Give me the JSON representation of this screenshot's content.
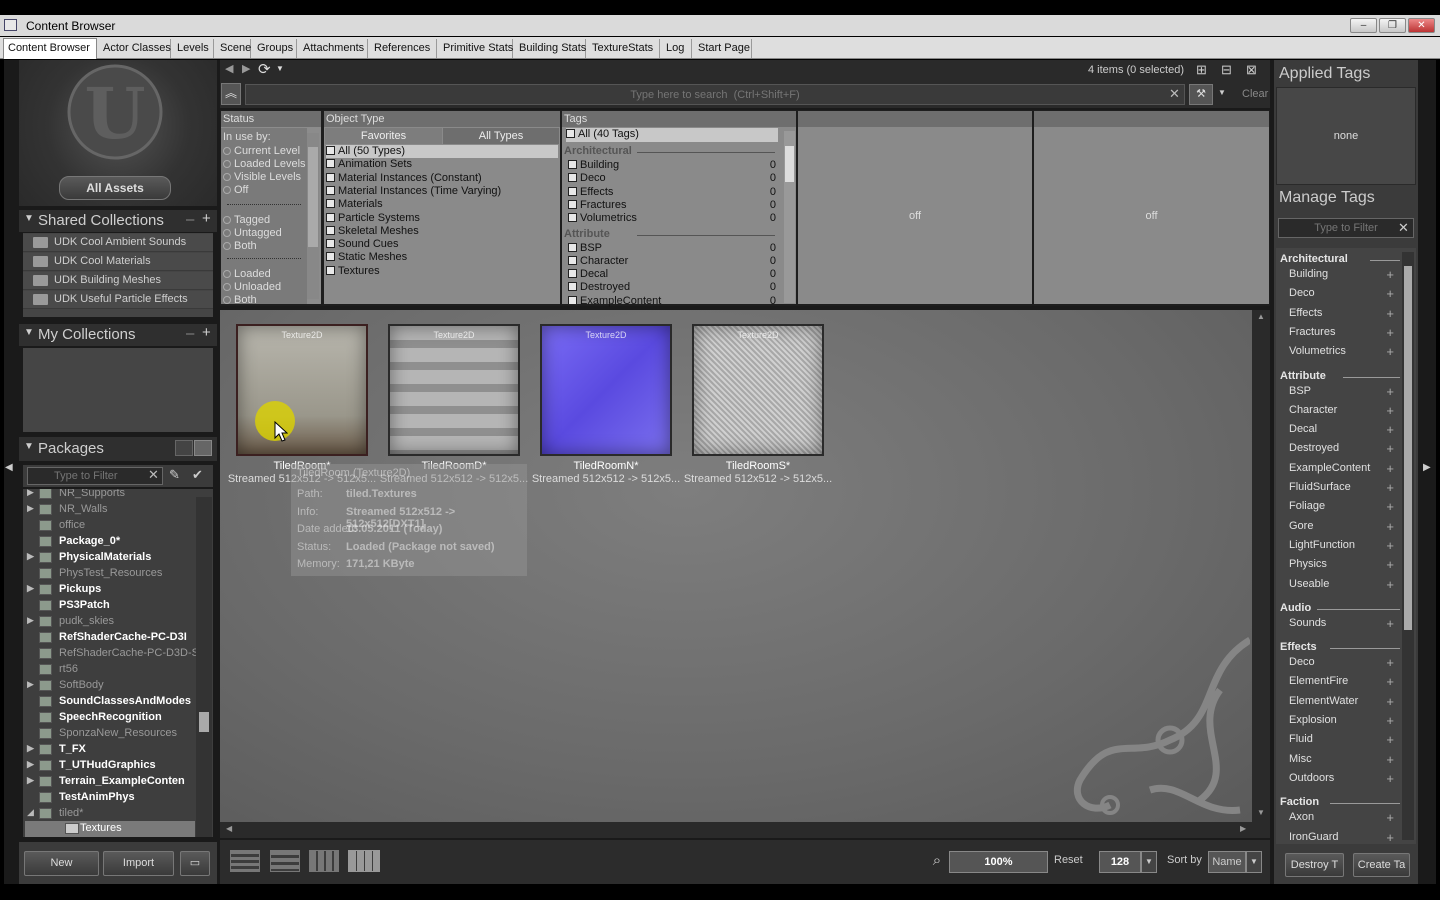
{
  "window": {
    "title": "Content Browser",
    "min": "‒",
    "max": "❐",
    "close": "✕"
  },
  "tabs": [
    "Content Browser",
    "Actor Classes",
    "Levels",
    "Scene",
    "Groups",
    "Attachments",
    "References",
    "Primitive Stats",
    "Building Stats",
    "TextureStats",
    "Log",
    "Start Page"
  ],
  "left": {
    "all_assets": "All Assets",
    "shared_collections": {
      "title": "Shared Collections",
      "items": [
        "UDK Cool Ambient Sounds",
        "UDK Cool Materials",
        "UDK Building Meshes",
        "UDK Useful Particle Effects"
      ]
    },
    "my_collections": {
      "title": "My Collections"
    },
    "packages": {
      "title": "Packages",
      "filter_placeholder": "Type to Filter",
      "items": [
        {
          "name": "NR_Supports",
          "bold": false,
          "arrow": true
        },
        {
          "name": "NR_Walls",
          "bold": false,
          "arrow": true
        },
        {
          "name": "office",
          "bold": false,
          "arrow": false
        },
        {
          "name": "Package_0*",
          "bold": true,
          "arrow": false
        },
        {
          "name": "PhysicalMaterials",
          "bold": true,
          "arrow": true
        },
        {
          "name": "PhysTest_Resources",
          "bold": false,
          "arrow": false
        },
        {
          "name": "Pickups",
          "bold": true,
          "arrow": true
        },
        {
          "name": "PS3Patch",
          "bold": true,
          "arrow": false
        },
        {
          "name": "pudk_skies",
          "bold": false,
          "arrow": true
        },
        {
          "name": "RefShaderCache-PC-D3I",
          "bold": true,
          "arrow": false
        },
        {
          "name": "RefShaderCache-PC-D3D-SI",
          "bold": false,
          "arrow": false
        },
        {
          "name": "rt56",
          "bold": false,
          "arrow": false
        },
        {
          "name": "SoftBody",
          "bold": false,
          "arrow": true
        },
        {
          "name": "SoundClassesAndModes",
          "bold": true,
          "arrow": false
        },
        {
          "name": "SpeechRecognition",
          "bold": true,
          "arrow": false
        },
        {
          "name": "SponzaNew_Resources",
          "bold": false,
          "arrow": false
        },
        {
          "name": "T_FX",
          "bold": true,
          "arrow": true
        },
        {
          "name": "T_UTHudGraphics",
          "bold": true,
          "arrow": true
        },
        {
          "name": "Terrain_ExampleConten",
          "bold": true,
          "arrow": true
        },
        {
          "name": "TestAnimPhys",
          "bold": true,
          "arrow": false
        },
        {
          "name": "tiled*",
          "bold": false,
          "arrow": true
        }
      ],
      "selected": "Textures"
    },
    "new": "New",
    "import": "Import"
  },
  "toolbar": {
    "items_count": "4 items (0 selected)",
    "search_placeholder": "Type here to search  (Ctrl+Shift+F)",
    "clear": "Clear"
  },
  "filters": {
    "status": {
      "title": "Status",
      "in_use_by": "In use by:",
      "opts1": [
        "Current Level",
        "Loaded Levels",
        "Visible Levels",
        "Off"
      ],
      "opts2": [
        "Tagged",
        "Untagged",
        "Both"
      ],
      "opts3": [
        "Loaded",
        "Unloaded",
        "Both"
      ]
    },
    "object_type": {
      "title": "Object Type",
      "favorites": "Favorites",
      "all_types": "All Types",
      "items": [
        "All (50 Types)",
        "Animation Sets",
        "Material Instances (Constant)",
        "Material Instances (Time Varying)",
        "Materials",
        "Particle Systems",
        "Skeletal Meshes",
        "Sound Cues",
        "Static Meshes",
        "Textures"
      ]
    },
    "tags": {
      "title": "Tags",
      "all": "All (40 Tags)",
      "groups": [
        {
          "name": "Architectural",
          "items": [
            "Building",
            "Deco",
            "Effects",
            "Fractures",
            "Volumetrics"
          ]
        },
        {
          "name": "Attribute",
          "items": [
            "BSP",
            "Character",
            "Decal",
            "Destroyed",
            "ExampleContent"
          ]
        }
      ],
      "count": "0"
    },
    "off1": "off",
    "off2": "off"
  },
  "assets": [
    {
      "type": "Texture2D",
      "name": "TiledRoom*",
      "info": "Streamed 512x512 -> 512x5...",
      "color": "#8d8a80"
    },
    {
      "type": "Texture2D",
      "name": "TiledRoomD*",
      "info": "Streamed 512x512 -> 512x5...",
      "color": "#a9a9a9"
    },
    {
      "type": "Texture2D",
      "name": "TiledRoomN*",
      "info": "Streamed 512x512 -> 512x5...",
      "color": "#6c5df0"
    },
    {
      "type": "Texture2D",
      "name": "TiledRoomS*",
      "info": "Streamed 512x512 -> 512x5...",
      "color": "#c4c4c4"
    }
  ],
  "tooltip": {
    "title": "TiledRoom  (Texture2D)",
    "rows": [
      [
        "Path:",
        "tiled.Textures"
      ],
      [
        "Info:",
        "Streamed 512x512 -> 512x512[DXT1]"
      ],
      [
        "Date added:",
        "13.05.2011 (Today)"
      ],
      [
        "Status:",
        "Loaded (Package not saved)"
      ],
      [
        "Memory:",
        "171,21 KByte"
      ]
    ]
  },
  "bottom": {
    "zoom": "100%",
    "reset": "Reset",
    "size": "128",
    "sort_by": "Sort by",
    "sort_value": "Name"
  },
  "right": {
    "applied_tags": "Applied Tags",
    "none": "none",
    "manage_tags": "Manage Tags",
    "filter_placeholder": "Type to Filter",
    "groups": [
      {
        "name": "Architectural",
        "items": [
          "Building",
          "Deco",
          "Effects",
          "Fractures",
          "Volumetrics"
        ]
      },
      {
        "name": "Attribute",
        "items": [
          "BSP",
          "Character",
          "Decal",
          "Destroyed",
          "ExampleContent",
          "FluidSurface",
          "Foliage",
          "Gore",
          "LightFunction",
          "Physics",
          "Useable"
        ]
      },
      {
        "name": "Audio",
        "items": [
          "Sounds"
        ]
      },
      {
        "name": "Effects",
        "items": [
          "Deco",
          "ElementFire",
          "ElementWater",
          "Explosion",
          "Fluid",
          "Misc",
          "Outdoors"
        ]
      },
      {
        "name": "Faction",
        "items": [
          "Axon",
          "IronGuard"
        ]
      }
    ],
    "destroy": "Destroy T",
    "create": "Create Ta"
  }
}
